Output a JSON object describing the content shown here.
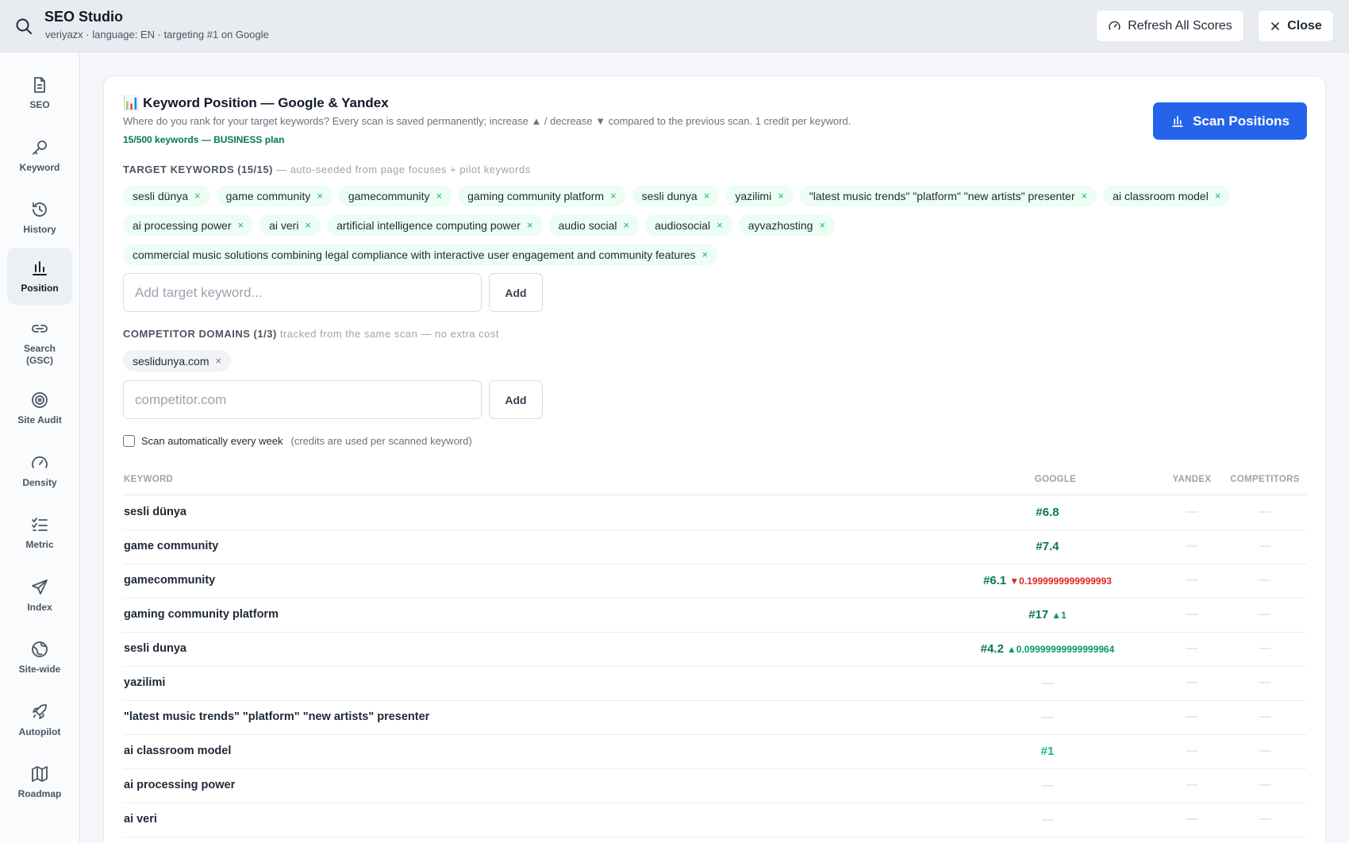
{
  "header": {
    "title": "SEO Studio",
    "subtitle": "veriyazx · language: EN · targeting #1 on Google",
    "refresh_label": "Refresh All Scores",
    "close_label": "Close"
  },
  "sidebar": {
    "items": [
      {
        "label": "SEO",
        "icon": "document-icon"
      },
      {
        "label": "Keyword",
        "icon": "key-icon"
      },
      {
        "label": "History",
        "icon": "history-icon"
      },
      {
        "label": "Position",
        "icon": "bar-chart-icon",
        "active": true
      },
      {
        "label": "Search (GSC)",
        "icon": "link-icon"
      },
      {
        "label": "Site Audit",
        "icon": "target-icon"
      },
      {
        "label": "Density",
        "icon": "gauge-icon"
      },
      {
        "label": "Metric",
        "icon": "checklist-icon"
      },
      {
        "label": "Index",
        "icon": "send-icon"
      },
      {
        "label": "Site-wide",
        "icon": "globe-icon"
      },
      {
        "label": "Autopilot",
        "icon": "rocket-icon"
      },
      {
        "label": "Roadmap",
        "icon": "map-icon"
      }
    ]
  },
  "position": {
    "title": "Keyword Position — Google & Yandex",
    "title_icon": "📊",
    "description": "Where do you rank for your target keywords? Every scan is saved permanently; increase ▲ / decrease ▼ compared to the previous scan. 1 credit per keyword.",
    "plan": "15/500 keywords — BUSINESS plan",
    "scan_label": "Scan Positions",
    "target_label": "TARGET KEYWORDS (15/15)",
    "target_note": "— auto-seeded from page focuses + pilot keywords",
    "keywords": [
      "sesli dünya",
      "game community",
      "gamecommunity",
      "gaming community platform",
      "sesli dunya",
      "yazilimi",
      "\"latest music trends\" \"platform\" \"new artists\" presenter",
      "ai classroom model",
      "ai processing power",
      "ai veri",
      "artificial intelligence computing power",
      "audio social",
      "audiosocial",
      "ayvazhosting",
      "commercial music solutions combining legal compliance with interactive user engagement and community features"
    ],
    "keyword_placeholder": "Add target keyword...",
    "add_label": "Add",
    "competitor_label": "COMPETITOR DOMAINS (1/3)",
    "competitor_note": "tracked from the same scan — no extra cost",
    "competitors": [
      "seslidunya.com"
    ],
    "competitor_placeholder": "competitor.com",
    "weekly_label": "Scan automatically every week",
    "weekly_note": "(credits are used per scanned keyword)",
    "remove_glyph": "×"
  },
  "table": {
    "headers": {
      "keyword": "KEYWORD",
      "google": "GOOGLE",
      "yandex": "YANDEX",
      "competitors": "COMPETITORS"
    },
    "dash": "—",
    "rows": [
      {
        "keyword": "sesli dünya",
        "google": "#6.8",
        "delta": "",
        "dir": ""
      },
      {
        "keyword": "game community",
        "google": "#7.4",
        "delta": "",
        "dir": ""
      },
      {
        "keyword": "gamecommunity",
        "google": "#6.1",
        "delta": "▼0.1999999999999993",
        "dir": "down"
      },
      {
        "keyword": "gaming community platform",
        "google": "#17",
        "delta": "▲1",
        "dir": "up"
      },
      {
        "keyword": "sesli dunya",
        "google": "#4.2",
        "delta": "▲0.09999999999999964",
        "dir": "up"
      },
      {
        "keyword": "yazilimi",
        "google": "",
        "delta": "",
        "dir": ""
      },
      {
        "keyword": "\"latest music trends\" \"platform\" \"new artists\" presenter",
        "google": "",
        "delta": "",
        "dir": ""
      },
      {
        "keyword": "ai classroom model",
        "google": "#1",
        "delta": "",
        "dir": "",
        "top": true
      },
      {
        "keyword": "ai processing power",
        "google": "",
        "delta": "",
        "dir": ""
      },
      {
        "keyword": "ai veri",
        "google": "",
        "delta": "",
        "dir": ""
      }
    ]
  },
  "colors": {
    "accent": "#2563eb",
    "positive": "#047857",
    "negative": "#dc2626",
    "chip_bg": "#ecfdf3"
  }
}
